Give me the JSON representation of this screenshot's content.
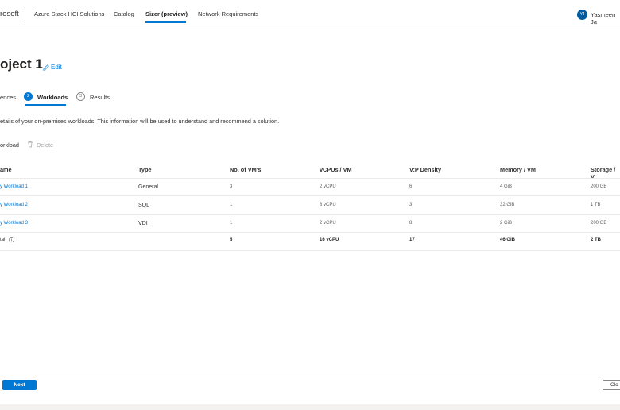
{
  "header": {
    "brand": "rosoft",
    "nav": [
      {
        "label": "Azure Stack HCI Solutions"
      },
      {
        "label": "Catalog"
      },
      {
        "label": "Sizer (preview)"
      },
      {
        "label": "Network Requirements"
      }
    ],
    "user_initials": "YJ",
    "user_name": "Yasmeen Ja"
  },
  "page": {
    "title": "oject 1",
    "edit_label": "Edit"
  },
  "steps": [
    {
      "label": "ences",
      "number": ""
    },
    {
      "label": "Workloads",
      "number": "2"
    },
    {
      "label": "Results",
      "number": "3"
    }
  ],
  "description": "etails of your on-premises workloads. This information will be used to understand and recommend a solution.",
  "commands": {
    "add_label": "orkload",
    "delete_label": "Delete"
  },
  "table": {
    "columns": [
      "ame",
      "Type",
      "No. of VM's",
      "vCPUs / VM",
      "V:P Density",
      "Memory / VM",
      "Storage / V"
    ],
    "rows": [
      {
        "name": "y Workload 1",
        "type": "General",
        "vms": "3",
        "vcpus": "2 vCPU",
        "density": "6",
        "memory": "4 GiB",
        "storage": "200 GB"
      },
      {
        "name": "y Workload 2",
        "type": "SQL",
        "vms": "1",
        "vcpus": "8 vCPU",
        "density": "3",
        "memory": "32 GiB",
        "storage": "1 TB"
      },
      {
        "name": "y Workload 3",
        "type": "VDI",
        "vms": "1",
        "vcpus": "2 vCPU",
        "density": "8",
        "memory": "2 GiB",
        "storage": "200 GB"
      }
    ],
    "total": {
      "label": "tal",
      "vms": "5",
      "vcpus": "16 vCPU",
      "density": "17",
      "memory": "46 GiB",
      "storage": "2 TB"
    }
  },
  "footer": {
    "next_label": "Next",
    "close_label": "Clo"
  },
  "colors": {
    "accent": "#0078d4",
    "text": "#323130",
    "disabled": "#a19f9d"
  }
}
